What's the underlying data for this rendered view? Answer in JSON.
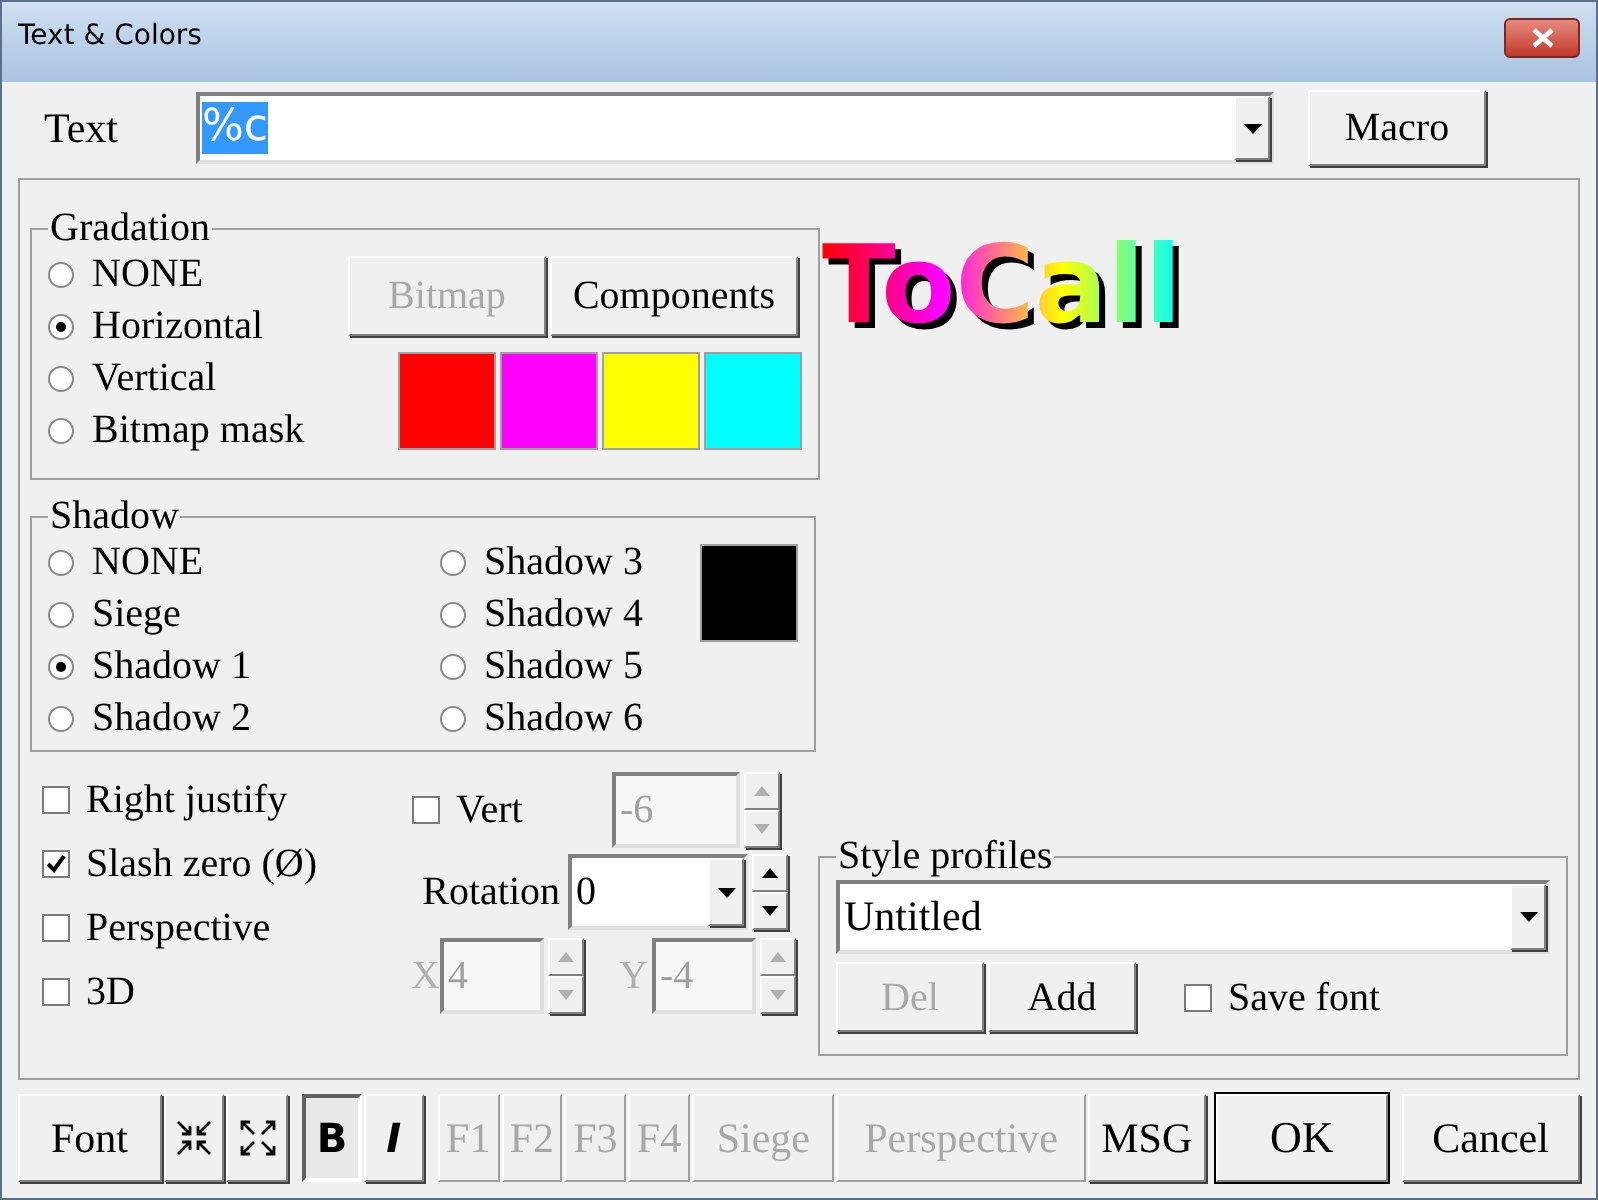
{
  "window": {
    "title": "Text & Colors"
  },
  "text_field": {
    "label": "Text",
    "value": "%c",
    "text_selected": true
  },
  "macro_button": {
    "label": "Macro"
  },
  "gradation": {
    "title": "Gradation",
    "options": [
      {
        "label": "NONE",
        "selected": false
      },
      {
        "label": "Horizontal",
        "selected": true
      },
      {
        "label": "Vertical",
        "selected": false
      },
      {
        "label": "Bitmap mask",
        "selected": false
      }
    ],
    "buttons": [
      {
        "label": "Bitmap",
        "disabled": true
      },
      {
        "label": "Components",
        "disabled": false
      }
    ],
    "swatches": [
      {
        "color": "#ff0000"
      },
      {
        "color": "#ff00ff"
      },
      {
        "color": "#ffff00"
      },
      {
        "color": "#00ffff"
      }
    ]
  },
  "preview": {
    "text": "ToCall"
  },
  "shadow": {
    "title": "Shadow",
    "color": "#000000",
    "options": [
      {
        "label": "NONE",
        "selected": false
      },
      {
        "label": "Siege",
        "selected": false
      },
      {
        "label": "Shadow 1",
        "selected": true
      },
      {
        "label": "Shadow 2",
        "selected": false
      },
      {
        "label": "Shadow 3",
        "selected": false
      },
      {
        "label": "Shadow 4",
        "selected": false
      },
      {
        "label": "Shadow 5",
        "selected": false
      },
      {
        "label": "Shadow 6",
        "selected": false
      }
    ]
  },
  "options": [
    {
      "label": "Right justify",
      "checked": false
    },
    {
      "label": "Slash zero (Ø)",
      "checked": true
    },
    {
      "label": "Perspective",
      "checked": false
    },
    {
      "label": "3D",
      "checked": false
    }
  ],
  "vert": {
    "label": "Vert",
    "checked": false,
    "value": "-6",
    "disabled": true
  },
  "rotation": {
    "label": "Rotation",
    "value": "0"
  },
  "offset_x": {
    "label": "X",
    "value": "4",
    "disabled": true
  },
  "offset_y": {
    "label": "Y",
    "value": "-4",
    "disabled": true
  },
  "style_profiles": {
    "title": "Style profiles",
    "value": "Untitled",
    "buttons": [
      {
        "label": "Del",
        "disabled": true
      },
      {
        "label": "Add",
        "disabled": false
      }
    ],
    "save_font": {
      "label": "Save font",
      "checked": false
    }
  },
  "toolbar": [
    {
      "kind": "button",
      "label": "Font",
      "disabled": false
    },
    {
      "kind": "shrink"
    },
    {
      "kind": "expand"
    },
    {
      "kind": "bold",
      "label": "B",
      "selected": true
    },
    {
      "kind": "italic",
      "label": "I",
      "selected": false
    },
    {
      "kind": "button",
      "label": "F1",
      "disabled": true
    },
    {
      "kind": "button",
      "label": "F2",
      "disabled": true
    },
    {
      "kind": "button",
      "label": "F3",
      "disabled": true
    },
    {
      "kind": "button",
      "label": "F4",
      "disabled": true
    },
    {
      "kind": "button",
      "label": "Siege",
      "disabled": true
    },
    {
      "kind": "button",
      "label": "Perspective",
      "disabled": true
    },
    {
      "kind": "button",
      "label": "MSG",
      "disabled": false
    },
    {
      "kind": "default",
      "label": "OK",
      "disabled": false
    },
    {
      "kind": "button",
      "label": "Cancel",
      "disabled": false
    }
  ]
}
